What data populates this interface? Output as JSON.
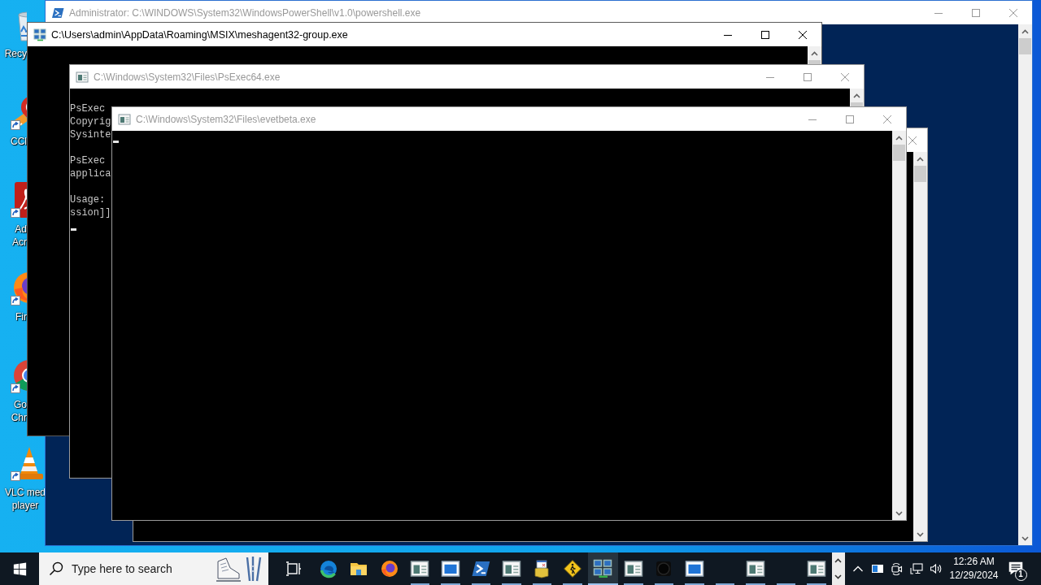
{
  "desktop_icons": [
    {
      "kind": "recycle-bin",
      "label_lines": [
        "Recy"
      ],
      "shortcut": false
    },
    {
      "kind": "ccleaner",
      "label_lines": [
        "CCl"
      ],
      "shortcut": true
    },
    {
      "kind": "acrobat",
      "label_lines": [
        "Ad",
        "Acr"
      ],
      "shortcut": true
    },
    {
      "kind": "firefox",
      "label_lines": [
        "Fir"
      ],
      "shortcut": true
    },
    {
      "kind": "chrome",
      "label_lines": [
        "Go",
        "Chr"
      ],
      "shortcut": true
    },
    {
      "kind": "vlc",
      "label_lines": [
        "VLC med",
        "player"
      ],
      "shortcut": true
    }
  ],
  "windows": [
    {
      "kind": "powershell",
      "title": "Administrator: C:\\WINDOWS\\System32\\WindowsPowerShell\\v1.0\\powershell.exe",
      "active": false
    },
    {
      "kind": "agent",
      "title": "C:\\Users\\admin\\AppData\\Roaming\\MSIX\\meshagent32-group.exe",
      "active": true
    },
    {
      "kind": "console",
      "title": "C:\\Windows\\System32\\Files\\PsExec64.exe",
      "active": false,
      "paragraphs": [
        [
          "PsExec",
          "Copyrig",
          "Sysinte"
        ],
        [
          "PsExec",
          "applica"
        ],
        [
          "Usage:",
          "ssion]]"
        ]
      ],
      "cursor": true
    },
    {
      "kind": "console",
      "title": "C:\\Windows\\System32\\Files\\evetbeta.exe",
      "active": false,
      "cursor": true
    },
    {
      "kind": "console",
      "active": false
    }
  ],
  "taskbar": {
    "search": {
      "placeholder": "Type here to search"
    },
    "items": [
      {
        "kind": "task-view",
        "running": false,
        "selected": false
      },
      {
        "kind": "edge",
        "running": false,
        "selected": false
      },
      {
        "kind": "explorer",
        "running": false,
        "selected": false
      },
      {
        "kind": "firefox",
        "running": false,
        "selected": false
      },
      {
        "kind": "console",
        "running": true,
        "selected": false
      },
      {
        "kind": "app-window",
        "running": true,
        "selected": false
      },
      {
        "kind": "powershell",
        "running": true,
        "selected": false
      },
      {
        "kind": "console",
        "running": true,
        "selected": false
      },
      {
        "kind": "installer",
        "running": true,
        "selected": false
      },
      {
        "kind": "warning-sign",
        "running": true,
        "selected": false
      },
      {
        "kind": "network",
        "running": true,
        "selected": true
      },
      {
        "kind": "console",
        "running": true,
        "selected": false
      },
      {
        "kind": "dark-circle",
        "running": true,
        "selected": false
      },
      {
        "kind": "app-window",
        "running": true,
        "selected": false
      },
      {
        "kind": "blank",
        "running": true,
        "selected": false
      },
      {
        "kind": "console",
        "running": true,
        "selected": false
      },
      {
        "kind": "blank",
        "running": true,
        "selected": false
      },
      {
        "kind": "console",
        "running": true,
        "selected": false
      }
    ],
    "clock": {
      "time": "12:26 AM",
      "date": "12/29/2024"
    },
    "notification_count": "1"
  }
}
